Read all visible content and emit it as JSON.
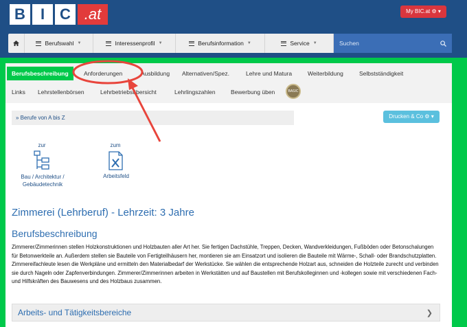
{
  "header": {
    "logo_letters": [
      "B",
      "I",
      "C"
    ],
    "logo_suffix": ".at",
    "account_button": "My BIC.at ⚙ ▾"
  },
  "nav": {
    "items": [
      {
        "label": "Berufswahl"
      },
      {
        "label": "Interessenprofil"
      },
      {
        "label": "Berufsinformation"
      },
      {
        "label": "Service"
      }
    ],
    "search_placeholder": "Suchen"
  },
  "tabs": [
    {
      "label": "Berufsbeschreibung",
      "active": true
    },
    {
      "label": "Anforderungen"
    },
    {
      "label": "Ausbildung"
    },
    {
      "label": "Alternativen/Spez."
    },
    {
      "label": "Lehre und Matura"
    },
    {
      "label": "Weiterbildung"
    },
    {
      "label": "Selbstständigkeit"
    },
    {
      "label": "Links"
    },
    {
      "label": "Lehrstellenbörsen"
    },
    {
      "label": "Lehrbetriebsübersicht"
    },
    {
      "label": "Lehrlingszahlen"
    },
    {
      "label": "Bewerbung üben"
    }
  ],
  "basic_badge": "BASIC",
  "breadcrumb": "» Berufe von A bis Z",
  "print_button": "Drucken & Co ⚙ ▾",
  "categories": [
    {
      "prefix": "zur",
      "label": "Bau / Architektur / Gebäudetechnik"
    },
    {
      "prefix": "zum",
      "label": "Arbeitsfeld"
    }
  ],
  "page_title": "Zimmerei (Lehrberuf) - Lehrzeit: 3 Jahre",
  "section_title": "Berufsbeschreibung",
  "description": "Zimmerer/Zimmerinnen stellen Holzkonstruktionen und Holzbauten aller Art her. Sie fertigen Dachstühle, Treppen, Decken, Wandverkleidungen, Fußböden oder Betonschalungen für Betonwerkteile an. Außerdem stellen sie Bauteile von Fertigteilhäusern her, montieren sie am Einsatzort und isolieren die Bauteile mit Wärme-, Schall- oder Brandschutzplatten. Zimmereifachleute lesen die Werkpläne und ermitteln den Materialbedarf der Werkstücke. Sie wählen die entsprechende Holzart aus, schneiden die Holzteile zurecht und verbinden sie durch Nageln oder Zapfenverbindungen. Zimmerer/Zimmerinnen arbeiten in Werkstätten und auf Baustellen mit Berufskolleginnen und -kollegen sowie mit verschiedenen Fach- und Hilfskräften des Bauwesens und des Holzbaus zusammen.",
  "accordion": {
    "label": "Arbeits- und Tätigkeitsbereiche"
  },
  "colors": {
    "brand_blue": "#1f4f86",
    "brand_green": "#00c94a",
    "accent_red": "#d9363e",
    "info_blue": "#5bc0de",
    "annotation_red": "#e8453c"
  }
}
